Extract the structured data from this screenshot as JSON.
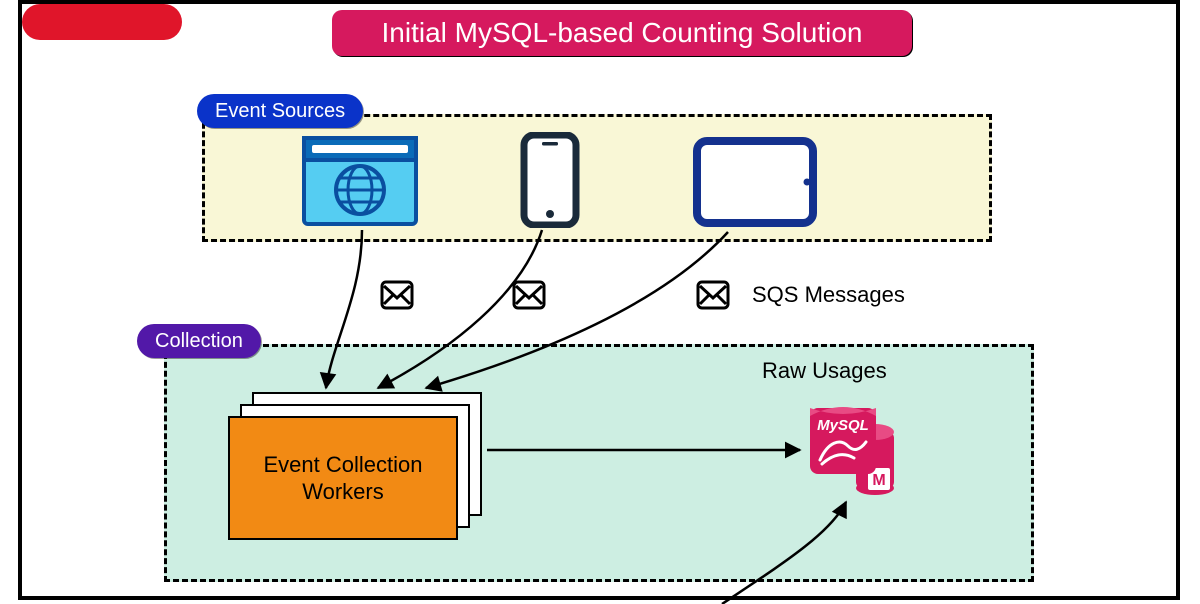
{
  "title": "Initial MySQL-based Counting Solution",
  "sections": {
    "sources": {
      "label": "Event Sources"
    },
    "collection": {
      "label": "Collection"
    }
  },
  "messages": {
    "label": "SQS Messages"
  },
  "raw_usages": {
    "label": "Raw Usages"
  },
  "workers": {
    "label": "Event Collection\nWorkers"
  },
  "mysql": {
    "label": "MySQL",
    "badge": "M"
  }
}
